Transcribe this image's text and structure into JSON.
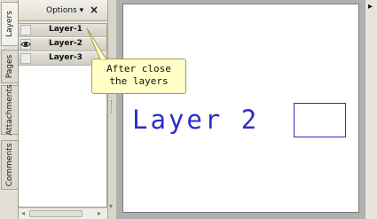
{
  "tabs": [
    {
      "label": "Layers",
      "active": true
    },
    {
      "label": "Pages",
      "active": false
    },
    {
      "label": "Attachments",
      "active": false
    },
    {
      "label": "Comments",
      "active": false
    }
  ],
  "panel": {
    "options_label": "Options ▾",
    "close_label": "×"
  },
  "layers": [
    {
      "name": "Layer-1",
      "visible": false
    },
    {
      "name": "Layer-2",
      "visible": true
    },
    {
      "name": "Layer-3",
      "visible": false
    }
  ],
  "callout": {
    "line1": "After close",
    "line2": "the layers"
  },
  "document": {
    "text": "Layer 2",
    "stroke_color": "#2c2cc9"
  },
  "icons": {
    "eye": "eye-icon",
    "close": "close-icon",
    "dropdown": "chevron-down-icon",
    "right_arrow": "triangle-right-icon"
  }
}
